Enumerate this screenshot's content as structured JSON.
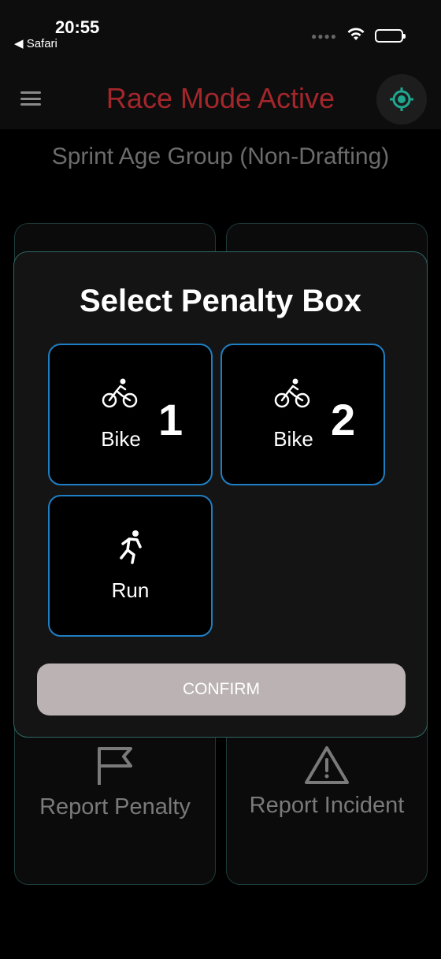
{
  "status_bar": {
    "time": "20:55",
    "back_app": "◀ Safari"
  },
  "header": {
    "title": "Race Mode Active",
    "title_color": "#a3262b",
    "accent_color": "#1fa88f"
  },
  "subtitle": "Sprint Age Group (Non-Drafting)",
  "background_tiles": {
    "left_action": {
      "label": "Report Penalty",
      "icon": "flag-icon"
    },
    "right_action": {
      "label": "Report Incident",
      "icon": "warning-triangle-icon"
    }
  },
  "modal": {
    "title": "Select Penalty Box",
    "border_color": "#2e6865",
    "tile_border_color": "#1f7fc4",
    "boxes": [
      {
        "label": "Bike",
        "number": "1",
        "icon": "bike-icon"
      },
      {
        "label": "Bike",
        "number": "2",
        "icon": "bike-icon"
      },
      {
        "label": "Run",
        "number": "",
        "icon": "run-icon"
      }
    ],
    "confirm_label": "CONFIRM",
    "confirm_color": "#bbb3b3"
  }
}
